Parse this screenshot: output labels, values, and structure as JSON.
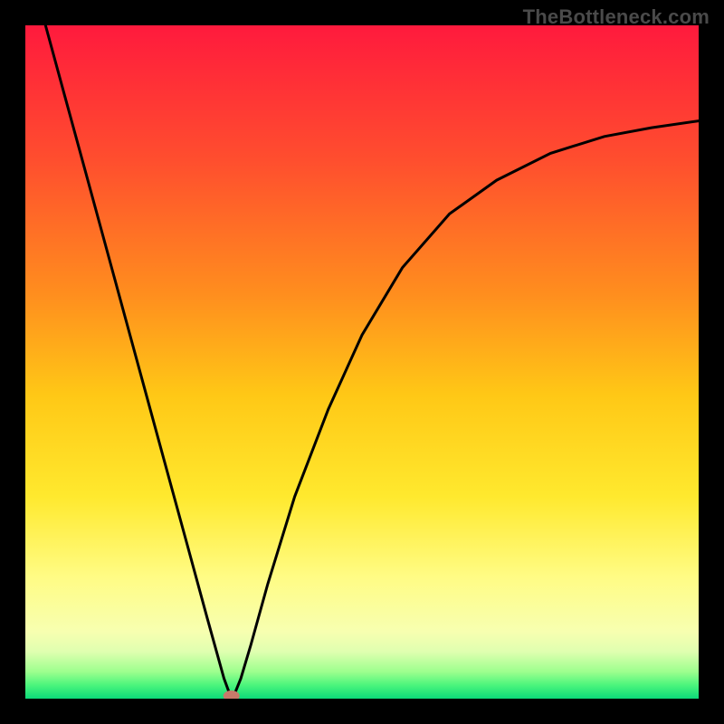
{
  "watermark": "TheBottleneck.com",
  "chart_data": {
    "type": "line",
    "title": "",
    "xlabel": "",
    "ylabel": "",
    "xlim": [
      0,
      1
    ],
    "ylim": [
      0,
      1
    ],
    "grid": false,
    "legend": false,
    "series": [
      {
        "name": "bottleneck-curve",
        "x": [
          0.03,
          0.06,
          0.09,
          0.12,
          0.15,
          0.18,
          0.21,
          0.24,
          0.27,
          0.295,
          0.306,
          0.31,
          0.32,
          0.335,
          0.36,
          0.4,
          0.45,
          0.5,
          0.56,
          0.63,
          0.7,
          0.78,
          0.86,
          0.93,
          1.0
        ],
        "y": [
          1.0,
          0.89,
          0.78,
          0.67,
          0.56,
          0.45,
          0.34,
          0.23,
          0.12,
          0.03,
          0.0,
          0.005,
          0.03,
          0.08,
          0.17,
          0.3,
          0.43,
          0.54,
          0.64,
          0.72,
          0.77,
          0.81,
          0.835,
          0.848,
          0.858
        ]
      }
    ],
    "marker": {
      "x": 0.306,
      "y": 0.0,
      "color": "#c77a6a"
    },
    "background_gradient": {
      "type": "vertical",
      "stops": [
        {
          "pos": 0.0,
          "color": "#ff1a3d"
        },
        {
          "pos": 0.2,
          "color": "#ff4e2e"
        },
        {
          "pos": 0.4,
          "color": "#ff8e1e"
        },
        {
          "pos": 0.55,
          "color": "#ffc816"
        },
        {
          "pos": 0.7,
          "color": "#ffe92e"
        },
        {
          "pos": 0.82,
          "color": "#fffc85"
        },
        {
          "pos": 0.9,
          "color": "#f7ffb0"
        },
        {
          "pos": 0.93,
          "color": "#e0ffb0"
        },
        {
          "pos": 0.96,
          "color": "#9dff8e"
        },
        {
          "pos": 0.98,
          "color": "#4bf57c"
        },
        {
          "pos": 1.0,
          "color": "#0cd979"
        }
      ]
    }
  }
}
